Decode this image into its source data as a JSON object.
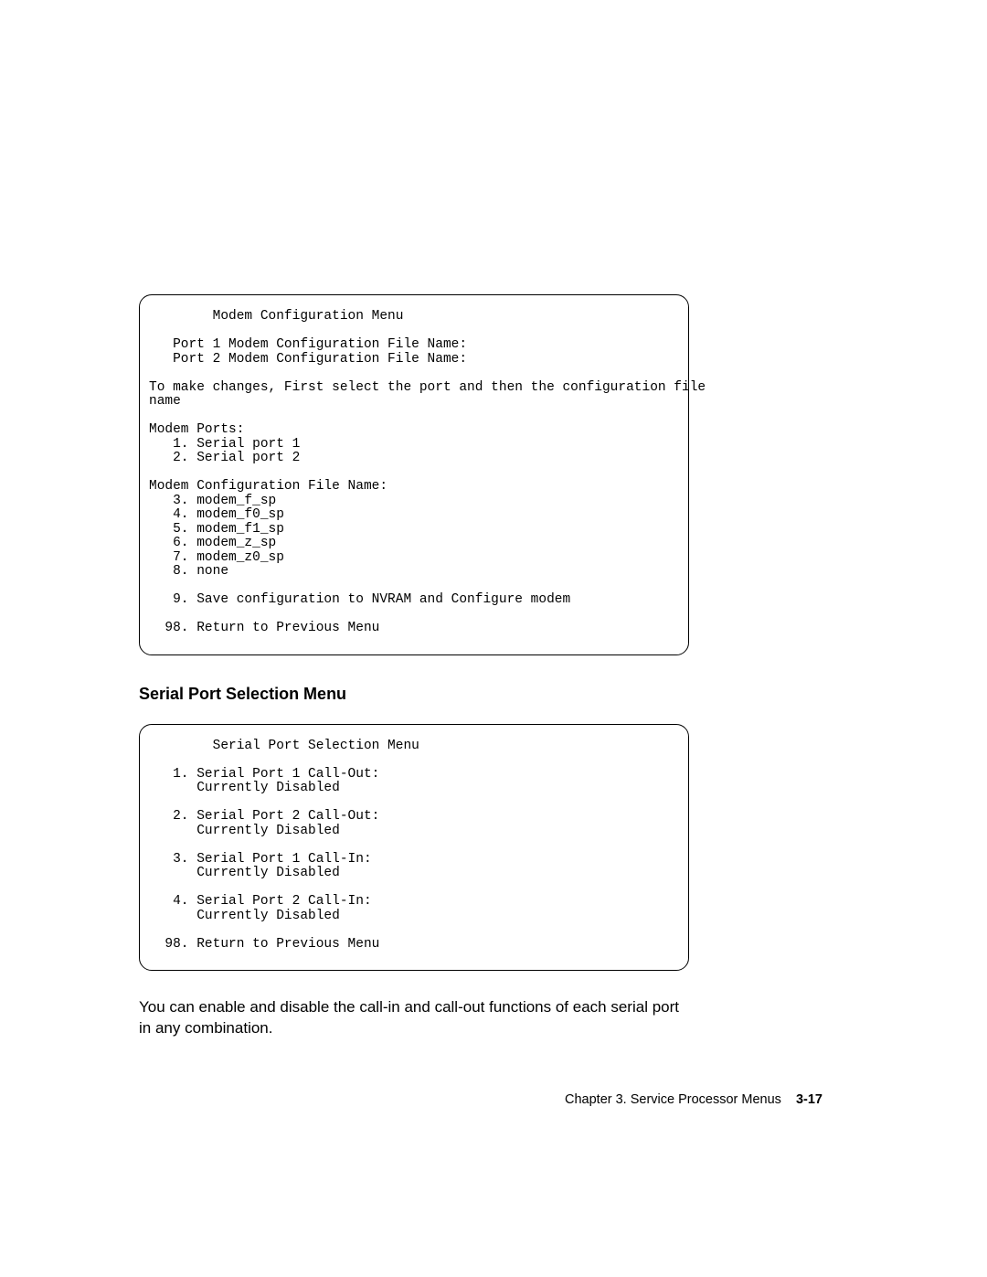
{
  "box1": {
    "title_line": "        Modem Configuration Menu",
    "port1_line": "   Port 1 Modem Configuration File Name:",
    "port2_line": "   Port 2 Modem Configuration File Name:",
    "instruct1": "To make changes, First select the port and then the configuration file",
    "instruct2": "name",
    "mp_header": "Modem Ports:",
    "mp1": "   1. Serial port 1",
    "mp2": "   2. Serial port 2",
    "cfg_header": "Modem Configuration File Name:",
    "c3": "   3. modem_f_sp",
    "c4": "   4. modem_f0_sp",
    "c5": "   5. modem_f1_sp",
    "c6": "   6. modem_z_sp",
    "c7": "   7. modem_z0_sp",
    "c8": "   8. none",
    "c9": "   9. Save configuration to NVRAM and Configure modem",
    "c98": "  98. Return to Previous Menu"
  },
  "section_title": "Serial Port Selection Menu",
  "box2": {
    "title_line": "        Serial Port Selection Menu",
    "i1a": "   1. Serial Port 1 Call-Out:",
    "i1b": "      Currently Disabled",
    "i2a": "   2. Serial Port 2 Call-Out:",
    "i2b": "      Currently Disabled",
    "i3a": "   3. Serial Port 1 Call-In:",
    "i3b": "      Currently Disabled",
    "i4a": "   4. Serial Port 2 Call-In:",
    "i4b": "      Currently Disabled",
    "i98": "  98. Return to Previous Menu"
  },
  "body_para": "You can enable and disable the call-in and call-out functions of each serial port in any combination.",
  "footer": {
    "chapter": "Chapter 3.  Service Processor Menus",
    "page": "3-17"
  }
}
